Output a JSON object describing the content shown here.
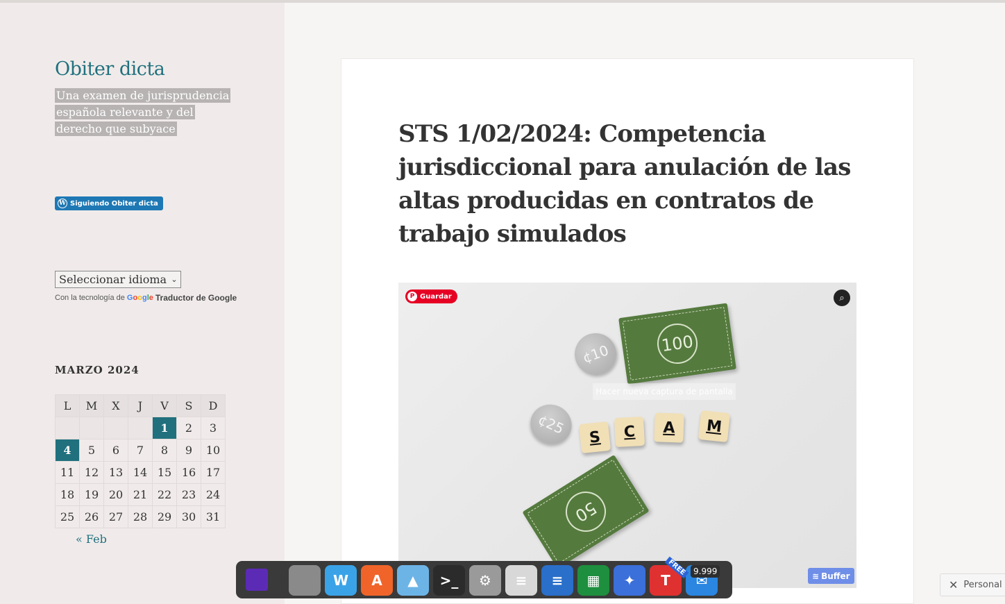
{
  "site": {
    "title": "Obiter dicta",
    "tagline": "Una examen de jurisprudencia española relevante y del derecho que subyace",
    "follow_label": "Siguiendo Obiter dicta"
  },
  "translate": {
    "select_value": "Seleccionar idioma",
    "powered_prefix": "Con la tecnología de",
    "google": "Google",
    "product": "Traductor de Google"
  },
  "calendar": {
    "title": "MARZO 2024",
    "weekdays": [
      "L",
      "M",
      "X",
      "J",
      "V",
      "S",
      "D"
    ],
    "weeks": [
      [
        "",
        "",
        "",
        "",
        "1",
        "2",
        "3"
      ],
      [
        "4",
        "5",
        "6",
        "7",
        "8",
        "9",
        "10"
      ],
      [
        "11",
        "12",
        "13",
        "14",
        "15",
        "16",
        "17"
      ],
      [
        "18",
        "19",
        "20",
        "21",
        "22",
        "23",
        "24"
      ],
      [
        "25",
        "26",
        "27",
        "28",
        "29",
        "30",
        "31"
      ]
    ],
    "linked_days": [
      "1",
      "4"
    ],
    "prev_label": "« Feb"
  },
  "post": {
    "title": "STS 1/02/2024: Competencia jurisdiccional para anulación de las altas producidas en contratos de trabajo simulados"
  },
  "image": {
    "pin_label": "Guardar",
    "capture_hint": "Hacer nueva captura de pantalla",
    "buffer_label": "Buffer",
    "bills": [
      "100",
      "50"
    ],
    "coins": [
      "¢10",
      "¢25"
    ],
    "tiles": [
      "S",
      "C",
      "A",
      "M"
    ]
  },
  "dock": {
    "items": [
      {
        "name": "dock-item-purple-app",
        "color": "#5b2bb5",
        "glyph": ""
      },
      {
        "name": "dock-item-files",
        "color": "#8a8a8a",
        "glyph": ""
      },
      {
        "name": "dock-item-wavebox",
        "color": "#3aa3e8",
        "glyph": "W"
      },
      {
        "name": "dock-item-app-store",
        "color": "#f0642a",
        "glyph": "A"
      },
      {
        "name": "dock-item-image-viewer",
        "color": "#6db4e6",
        "glyph": "▲"
      },
      {
        "name": "dock-item-terminal",
        "color": "#2b2b2b",
        "glyph": ">_"
      },
      {
        "name": "dock-item-settings",
        "color": "#9a9a9a",
        "glyph": "⚙"
      },
      {
        "name": "dock-item-document-viewer",
        "color": "#d8d8d8",
        "glyph": "≡"
      },
      {
        "name": "dock-item-writer",
        "color": "#2a6fc9",
        "glyph": "≡"
      },
      {
        "name": "dock-item-calc",
        "color": "#1e8f3e",
        "glyph": "▦"
      },
      {
        "name": "dock-item-bird-app",
        "color": "#3b6fd9",
        "glyph": "✦"
      },
      {
        "name": "dock-item-t-app",
        "color": "#e03131",
        "glyph": "T"
      },
      {
        "name": "dock-item-mail",
        "color": "#2a86e0",
        "glyph": "✉"
      }
    ],
    "free_label": "FREE",
    "badge": "9.999"
  },
  "customizer": {
    "label": "Personal"
  },
  "colors": {
    "accent": "#20707e",
    "follow_blue": "#1e78b4",
    "pinterest_red": "#e60023",
    "buffer_blue": "#6e8ee8"
  }
}
